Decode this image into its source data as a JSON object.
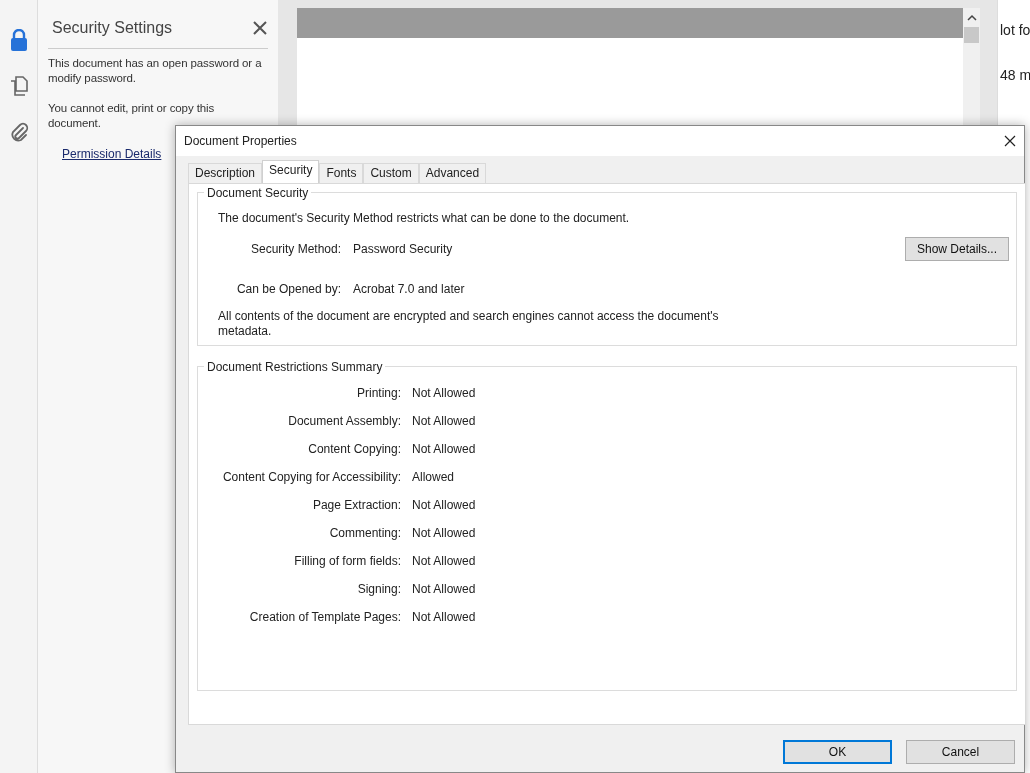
{
  "tool_rail": [
    {
      "kind": "lock",
      "selected": true
    },
    {
      "kind": "pages",
      "selected": false
    },
    {
      "kind": "attachment",
      "selected": false
    }
  ],
  "security_panel": {
    "title": "Security Settings",
    "paragraphs": [
      "This document has an open password or a modify password.",
      "You cannot edit, print or copy this document."
    ],
    "link": "Permission Details"
  },
  "right_panel": {
    "texts": [
      "lot fo",
      "48 m"
    ]
  },
  "dialog": {
    "title": "Document Properties",
    "tabs": [
      {
        "label": "Description",
        "selected": false
      },
      {
        "label": "Security",
        "selected": true
      },
      {
        "label": "Fonts",
        "selected": false
      },
      {
        "label": "Custom",
        "selected": false
      },
      {
        "label": "Advanced",
        "selected": false
      }
    ],
    "document_security": {
      "title": "Document Security",
      "intro": "The document's Security Method restricts what can be done to the document.",
      "fields": [
        {
          "label": "Security Method:",
          "value": "Password Security"
        },
        {
          "label": "Can be Opened by:",
          "value": "Acrobat 7.0 and later"
        }
      ],
      "button": "Show Details...",
      "note": "All contents of the document are encrypted and search engines cannot access the document's metadata."
    },
    "restrictions": {
      "title": "Document Restrictions Summary",
      "rows": [
        {
          "label": "Printing:",
          "value": "Not Allowed"
        },
        {
          "label": "Document Assembly:",
          "value": "Not Allowed"
        },
        {
          "label": "Content Copying:",
          "value": "Not Allowed"
        },
        {
          "label": "Content Copying for Accessibility:",
          "value": "Allowed"
        },
        {
          "label": "Page Extraction:",
          "value": "Not Allowed"
        },
        {
          "label": "Commenting:",
          "value": "Not Allowed"
        },
        {
          "label": "Filling of form fields:",
          "value": "Not Allowed"
        },
        {
          "label": "Signing:",
          "value": "Not Allowed"
        },
        {
          "label": "Creation of Template Pages:",
          "value": "Not Allowed"
        }
      ]
    },
    "buttons": [
      {
        "label": "OK",
        "default": true
      },
      {
        "label": "Cancel",
        "default": false
      }
    ]
  }
}
